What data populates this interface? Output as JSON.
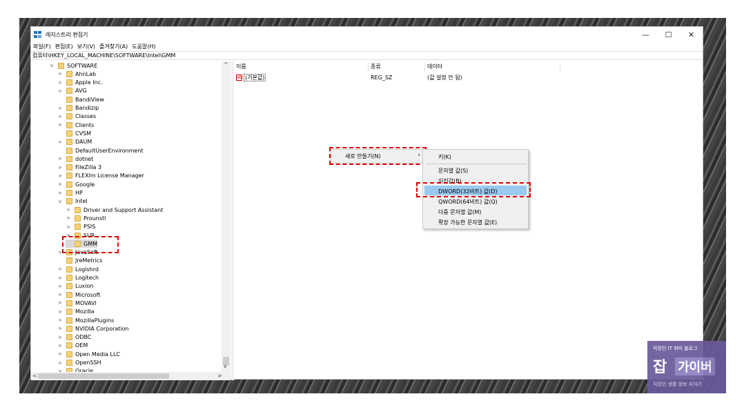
{
  "window": {
    "title": "레지스트리 편집기",
    "minimize": "—",
    "maximize": "☐",
    "close": "✕"
  },
  "menu": [
    "파일(F)",
    "편집(E)",
    "보기(V)",
    "즐겨찾기(A)",
    "도움말(H)"
  ],
  "address": "컴퓨터\\HKEY_LOCAL_MACHINE\\SOFTWARE\\Intel\\GMM",
  "tree": [
    {
      "label": "SOFTWARE",
      "exp": "v",
      "level": 0
    },
    {
      "label": "AhnLab",
      "exp": ">",
      "level": 1
    },
    {
      "label": "Apple Inc.",
      "exp": ">",
      "level": 1
    },
    {
      "label": "AVG",
      "exp": ">",
      "level": 1
    },
    {
      "label": "BandiView",
      "exp": "",
      "level": 1
    },
    {
      "label": "Bandizip",
      "exp": ">",
      "level": 1
    },
    {
      "label": "Classes",
      "exp": ">",
      "level": 1
    },
    {
      "label": "Clients",
      "exp": ">",
      "level": 1
    },
    {
      "label": "CVSM",
      "exp": "",
      "level": 1
    },
    {
      "label": "DAUM",
      "exp": ">",
      "level": 1
    },
    {
      "label": "DefaultUserEnvironment",
      "exp": "",
      "level": 1
    },
    {
      "label": "dotnet",
      "exp": ">",
      "level": 1
    },
    {
      "label": "FileZilla 3",
      "exp": ">",
      "level": 1
    },
    {
      "label": "FLEXlm License Manager",
      "exp": ">",
      "level": 1
    },
    {
      "label": "Google",
      "exp": ">",
      "level": 1
    },
    {
      "label": "HP",
      "exp": ">",
      "level": 1
    },
    {
      "label": "Intel",
      "exp": "v",
      "level": 1
    },
    {
      "label": "Driver and Support Assistant",
      "exp": ">",
      "level": 2
    },
    {
      "label": "Prounstl",
      "exp": ">",
      "level": 2
    },
    {
      "label": "PSIS",
      "exp": ">",
      "level": 2
    },
    {
      "label": "SUR",
      "exp": ">",
      "level": 2
    },
    {
      "label": "GMM",
      "exp": "",
      "level": 2
    },
    {
      "label": "JavaSoft",
      "exp": ">",
      "level": 1
    },
    {
      "label": "JreMetrics",
      "exp": "",
      "level": 1
    },
    {
      "label": "Logishrd",
      "exp": ">",
      "level": 1
    },
    {
      "label": "Logitech",
      "exp": ">",
      "level": 1
    },
    {
      "label": "Luxion",
      "exp": ">",
      "level": 1
    },
    {
      "label": "Microsoft",
      "exp": ">",
      "level": 1
    },
    {
      "label": "MOVAVI",
      "exp": ">",
      "level": 1
    },
    {
      "label": "Mozilla",
      "exp": ">",
      "level": 1
    },
    {
      "label": "MozillaPlugins",
      "exp": ">",
      "level": 1
    },
    {
      "label": "NVIDIA Corporation",
      "exp": ">",
      "level": 1
    },
    {
      "label": "ODBC",
      "exp": ">",
      "level": 1
    },
    {
      "label": "OEM",
      "exp": ">",
      "level": 1
    },
    {
      "label": "Open Media LLC",
      "exp": ">",
      "level": 1
    },
    {
      "label": "OpenSSH",
      "exp": ">",
      "level": 1
    },
    {
      "label": "Oracle",
      "exp": ">",
      "level": 1
    }
  ],
  "columns": {
    "name": "이름",
    "type": "종류",
    "data": "데이터"
  },
  "row": {
    "name": "(기본값)",
    "type": "REG_SZ",
    "data": "(값 설정 안 됨)",
    "icon": "ab"
  },
  "context_menu": {
    "new": "새로 만들기(N)",
    "chevron": "›",
    "items": [
      "키(K)",
      "문자열 값(S)",
      "이진값(B)",
      "DWORD(32비트) 값(D)",
      "QWORD(64비트) 값(Q)",
      "다중 문자열 값(M)",
      "확장 가능한 문자열 값(E)"
    ]
  },
  "watermark": {
    "line1": "직장인 IT 취미 블로그",
    "big1": "잡",
    "big2": "가이버",
    "line2": "직장인 생활 정보 지식기"
  },
  "colors": {
    "highlight": "#99c9ef",
    "annotation": "#dd0000",
    "folder": "#f5d17a"
  }
}
